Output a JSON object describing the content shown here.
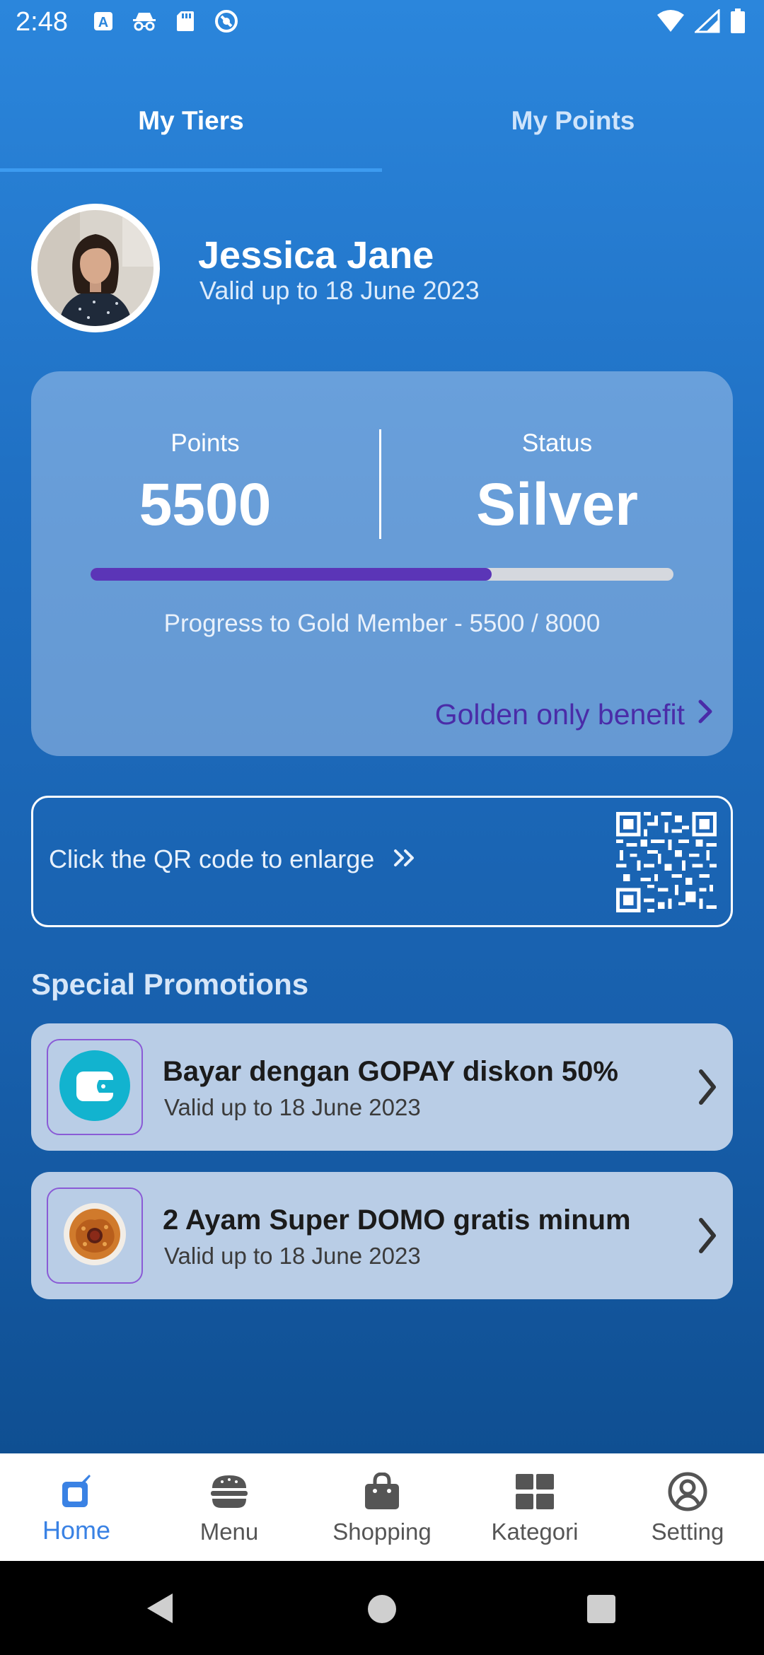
{
  "status_bar": {
    "time": "2:48",
    "icons_left": [
      "font-a-icon",
      "incognito-icon",
      "sd-card-icon",
      "at-sign-icon"
    ],
    "icons_right": [
      "wifi-icon",
      "signal-icon",
      "battery-icon"
    ]
  },
  "tabs": [
    {
      "label": "My Tiers",
      "active": true
    },
    {
      "label": "My Points",
      "active": false
    }
  ],
  "profile": {
    "name": "Jessica Jane",
    "valid_until": "Valid up to 18 June 2023"
  },
  "points_card": {
    "points_label": "Points",
    "points_value": "5500",
    "status_label": "Status",
    "status_value": "Silver",
    "progress_current": 5500,
    "progress_target": 8000,
    "progress_text": "Progress to Gold Member - 5500 / 8000",
    "benefit_link": "Golden only benefit",
    "accent_color": "#5b35b7"
  },
  "qr": {
    "text": "Click the QR code to enlarge"
  },
  "promotions": {
    "title": "Special Promotions",
    "items": [
      {
        "name": "Bayar dengan GOPAY diskon 50%",
        "valid": "Valid up to 18 June 2023",
        "icon": "wallet-icon"
      },
      {
        "name": "2 Ayam Super DOMO gratis minum",
        "valid": "Valid up to 18 June 2023",
        "icon": "fried-chicken-image"
      }
    ]
  },
  "bottom_nav": [
    {
      "label": "Home",
      "icon": "home-icon",
      "active": true
    },
    {
      "label": "Menu",
      "icon": "burger-icon",
      "active": false
    },
    {
      "label": "Shopping",
      "icon": "shopping-bag-icon",
      "active": false
    },
    {
      "label": "Kategori",
      "icon": "grid-icon",
      "active": false
    },
    {
      "label": "Setting",
      "icon": "user-circle-icon",
      "active": false
    }
  ]
}
